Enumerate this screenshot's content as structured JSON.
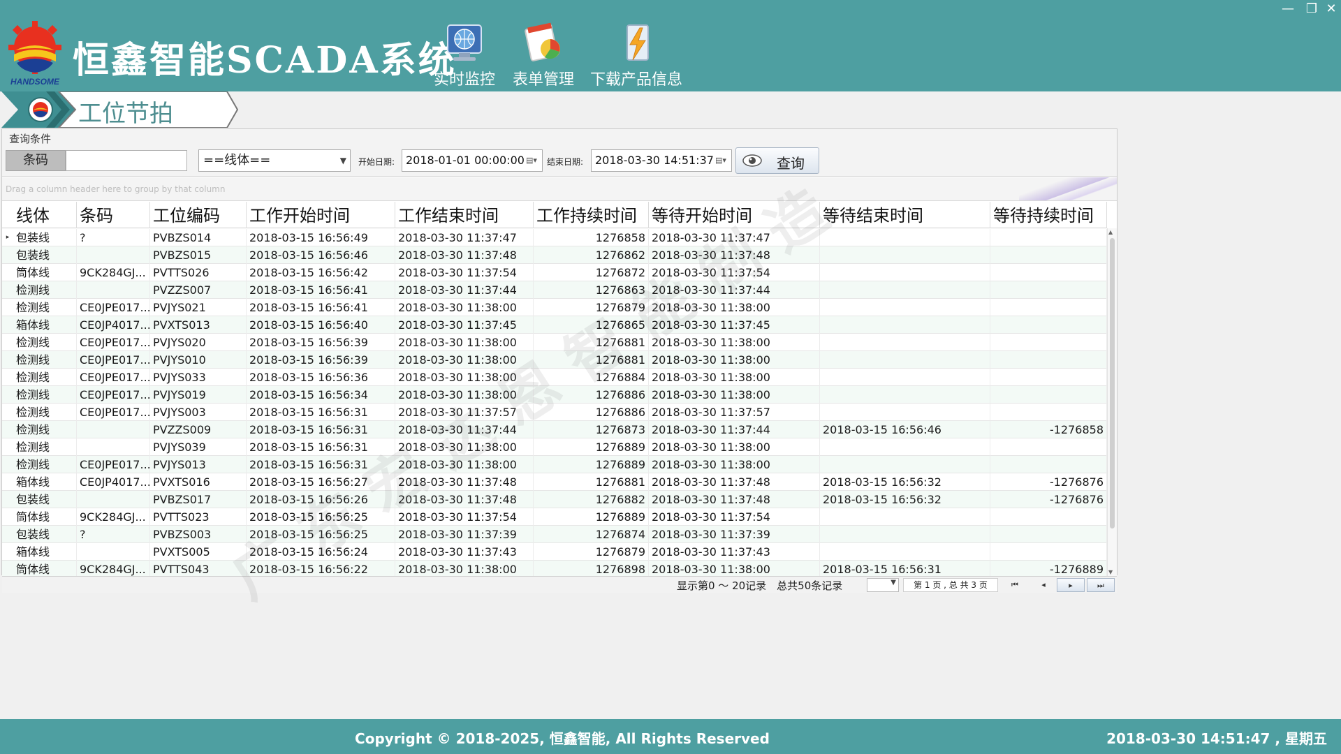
{
  "header": {
    "logo_text": "HANDSOME",
    "app_title": "恒鑫智能SCADA系统",
    "nav": [
      {
        "label": "实时监控",
        "icon": "monitor-globe-icon"
      },
      {
        "label": "表单管理",
        "icon": "report-chart-icon"
      },
      {
        "label": "下载产品信息",
        "icon": "download-bolt-icon"
      }
    ],
    "window_controls": {
      "minimize": "—",
      "maximize": "❐",
      "close": "✕"
    }
  },
  "page_tab": {
    "label": "工位节拍"
  },
  "query": {
    "title": "查询条件",
    "barcode_label": "条码",
    "barcode_value": "",
    "line_select": "==线体==",
    "start_label": "开始日期:",
    "start_value": "2018-01-01 00:00:00",
    "end_label": "结束日期:",
    "end_value": "2018-03-30 14:51:37",
    "query_button": "查询"
  },
  "group_hint": "Drag a column header here to group by that column",
  "table": {
    "columns": [
      "线体",
      "条码",
      "工位编码",
      "工作开始时间",
      "工作结束时间",
      "工作持续时间",
      "等待开始时间",
      "等待结束时间",
      "等待持续时间"
    ],
    "rows": [
      [
        "包装线",
        "?",
        "PVBZS014",
        "2018-03-15 16:56:49",
        "2018-03-30 11:37:47",
        "1276858",
        "2018-03-30 11:37:47",
        "",
        ""
      ],
      [
        "包装线",
        "",
        "PVBZS015",
        "2018-03-15 16:56:46",
        "2018-03-30 11:37:48",
        "1276862",
        "2018-03-30 11:37:48",
        "",
        ""
      ],
      [
        "筒体线",
        "9CK284GJ...",
        "PVTTS026",
        "2018-03-15 16:56:42",
        "2018-03-30 11:37:54",
        "1276872",
        "2018-03-30 11:37:54",
        "",
        ""
      ],
      [
        "检测线",
        "",
        "PVZZS007",
        "2018-03-15 16:56:41",
        "2018-03-30 11:37:44",
        "1276863",
        "2018-03-30 11:37:44",
        "",
        ""
      ],
      [
        "检测线",
        "CE0JPE017...",
        "PVJYS021",
        "2018-03-15 16:56:41",
        "2018-03-30 11:38:00",
        "1276879",
        "2018-03-30 11:38:00",
        "",
        ""
      ],
      [
        "箱体线",
        "CE0JP4017...",
        "PVXTS013",
        "2018-03-15 16:56:40",
        "2018-03-30 11:37:45",
        "1276865",
        "2018-03-30 11:37:45",
        "",
        ""
      ],
      [
        "检测线",
        "CE0JPE017...",
        "PVJYS020",
        "2018-03-15 16:56:39",
        "2018-03-30 11:38:00",
        "1276881",
        "2018-03-30 11:38:00",
        "",
        ""
      ],
      [
        "检测线",
        "CE0JPE017...",
        "PVJYS010",
        "2018-03-15 16:56:39",
        "2018-03-30 11:38:00",
        "1276881",
        "2018-03-30 11:38:00",
        "",
        ""
      ],
      [
        "检测线",
        "CE0JPE017...",
        "PVJYS033",
        "2018-03-15 16:56:36",
        "2018-03-30 11:38:00",
        "1276884",
        "2018-03-30 11:38:00",
        "",
        ""
      ],
      [
        "检测线",
        "CE0JPE017...",
        "PVJYS019",
        "2018-03-15 16:56:34",
        "2018-03-30 11:38:00",
        "1276886",
        "2018-03-30 11:38:00",
        "",
        ""
      ],
      [
        "检测线",
        "CE0JPE017...",
        "PVJYS003",
        "2018-03-15 16:56:31",
        "2018-03-30 11:37:57",
        "1276886",
        "2018-03-30 11:37:57",
        "",
        ""
      ],
      [
        "检测线",
        "",
        "PVZZS009",
        "2018-03-15 16:56:31",
        "2018-03-30 11:37:44",
        "1276873",
        "2018-03-30 11:37:44",
        "2018-03-15 16:56:46",
        "-1276858"
      ],
      [
        "检测线",
        "",
        "PVJYS039",
        "2018-03-15 16:56:31",
        "2018-03-30 11:38:00",
        "1276889",
        "2018-03-30 11:38:00",
        "",
        ""
      ],
      [
        "检测线",
        "CE0JPE017...",
        "PVJYS013",
        "2018-03-15 16:56:31",
        "2018-03-30 11:38:00",
        "1276889",
        "2018-03-30 11:38:00",
        "",
        ""
      ],
      [
        "箱体线",
        "CE0JP4017...",
        "PVXTS016",
        "2018-03-15 16:56:27",
        "2018-03-30 11:37:48",
        "1276881",
        "2018-03-30 11:37:48",
        "2018-03-15 16:56:32",
        "-1276876"
      ],
      [
        "包装线",
        "",
        "PVBZS017",
        "2018-03-15 16:56:26",
        "2018-03-30 11:37:48",
        "1276882",
        "2018-03-30 11:37:48",
        "2018-03-15 16:56:32",
        "-1276876"
      ],
      [
        "筒体线",
        "9CK284GJ...",
        "PVTTS023",
        "2018-03-15 16:56:25",
        "2018-03-30 11:37:54",
        "1276889",
        "2018-03-30 11:37:54",
        "",
        ""
      ],
      [
        "包装线",
        "?",
        "PVBZS003",
        "2018-03-15 16:56:25",
        "2018-03-30 11:37:39",
        "1276874",
        "2018-03-30 11:37:39",
        "",
        ""
      ],
      [
        "箱体线",
        "",
        "PVXTS005",
        "2018-03-15 16:56:24",
        "2018-03-30 11:37:43",
        "1276879",
        "2018-03-30 11:37:43",
        "",
        ""
      ],
      [
        "筒体线",
        "9CK284GJ...",
        "PVTTS043",
        "2018-03-15 16:56:22",
        "2018-03-30 11:38:00",
        "1276898",
        "2018-03-30 11:38:00",
        "2018-03-15 16:56:31",
        "-1276889"
      ]
    ]
  },
  "pager": {
    "info": "显示第0 ～ 20记录　总共50条记录",
    "pages": "第 1 页 , 总 共 3 页",
    "first": "⏮",
    "prev": "◂",
    "next": "▸",
    "last": "⏭"
  },
  "watermark": "广东宏达恩智能制造",
  "footer": {
    "copyright": "Copyright © 2018-2025, 恒鑫智能, All Rights Reserved",
    "clock": "2018-03-30 14:51:47 , 星期五"
  },
  "colors": {
    "header_bg": "#4e9fa1",
    "row_alt": "#f3faf6",
    "footer_bg": "#4e9fa1"
  }
}
